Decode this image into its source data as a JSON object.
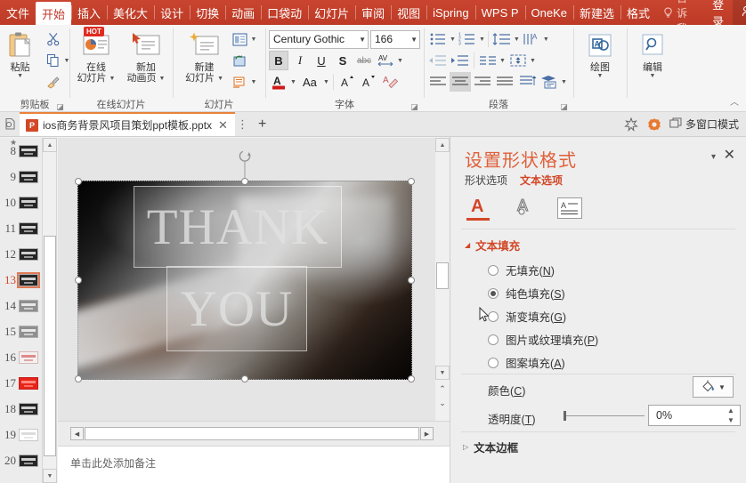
{
  "menubar": {
    "items": [
      {
        "label": "文件",
        "active": false
      },
      {
        "label": "开始",
        "active": true
      },
      {
        "label": "插入",
        "active": false
      },
      {
        "label": "美化大",
        "active": false
      },
      {
        "label": "设计",
        "active": false
      },
      {
        "label": "切换",
        "active": false
      },
      {
        "label": "动画",
        "active": false
      },
      {
        "label": "口袋动",
        "active": false
      },
      {
        "label": "幻灯片",
        "active": false
      },
      {
        "label": "审阅",
        "active": false
      },
      {
        "label": "视图",
        "active": false
      },
      {
        "label": "iSpring",
        "active": false
      },
      {
        "label": "WPS P",
        "active": false
      },
      {
        "label": "OneKe",
        "active": false
      },
      {
        "label": "新建选",
        "active": false
      },
      {
        "label": "格式",
        "active": false
      }
    ],
    "tell_me": "告诉我...",
    "login": "登录",
    "share": "共享",
    "accent_color": "#c0392b"
  },
  "ribbon": {
    "groups": [
      {
        "name": "剪贴板",
        "paste_label": "粘贴",
        "cut_tip": "剪切",
        "copy_tip": "复制",
        "painter_tip": "格式刷"
      },
      {
        "name": "在线幻灯片",
        "buttons": [
          {
            "line1": "在线",
            "line2": "幻灯片",
            "badge": "HOT"
          },
          {
            "line1": "新加",
            "line2": "动画页",
            "badge": ""
          }
        ]
      },
      {
        "name": "幻灯片",
        "buttons": [
          {
            "line1": "新建",
            "line2": "幻灯片"
          }
        ],
        "layout_tip": "版式",
        "reset_tip": "重置",
        "section_tip": "节"
      },
      {
        "name": "字体",
        "font_family": "Century Gothic",
        "font_size": "166",
        "bold": "B",
        "italic": "I",
        "underline": "U",
        "strike": "S",
        "text_effects": "abc",
        "char_spacing": "AV",
        "color_a": "A",
        "change_case": "Aa",
        "grow_font": "A",
        "shrink_font": "A",
        "clear_format_tip": "清除格式"
      },
      {
        "name": "段落",
        "bullets_tip": "项目符号",
        "numbering_tip": "编号",
        "line_spacing_tip": "行距",
        "text_direction_tip": "文字方向",
        "decrease_indent_tip": "减少缩进",
        "increase_indent_tip": "增加缩进",
        "align_columns_tip": "分栏",
        "align_text_tip": "对齐文本",
        "align_left_tip": "左对齐",
        "align_center_tip": "居中",
        "align_right_tip": "右对齐",
        "justify_tip": "两端对齐",
        "distribute_tip": "分散对齐",
        "smartart_tip": "转换为SmartArt"
      },
      {
        "name": "",
        "buttons": [
          {
            "line1": "绘图",
            "line2": ""
          },
          {
            "line1": "编辑",
            "line2": ""
          }
        ]
      }
    ],
    "collapse_tip": "折叠功能区"
  },
  "tabbar": {
    "document_name": "ios商务背景风项目策划ppt模板.pptx",
    "close_tab": "✕",
    "more_menu": "⋮",
    "new_tab": "+",
    "multiwindow_label": "多窗口模式",
    "backstage_tip": "首页",
    "tools_tip": "工具",
    "settings_tip": "设置"
  },
  "thumbnails": {
    "selected_index": 13,
    "slides": [
      {
        "num": "8",
        "style": "dark"
      },
      {
        "num": "9",
        "style": "dark"
      },
      {
        "num": "10",
        "style": "dark"
      },
      {
        "num": "11",
        "style": "dark"
      },
      {
        "num": "12",
        "style": "dark"
      },
      {
        "num": "13",
        "style": "dark"
      },
      {
        "num": "14",
        "style": "gray"
      },
      {
        "num": "15",
        "style": "gray"
      },
      {
        "num": "16",
        "style": "light"
      },
      {
        "num": "17",
        "style": "red"
      },
      {
        "num": "18",
        "style": "dark"
      },
      {
        "num": "19",
        "style": "white"
      },
      {
        "num": "20",
        "style": "dark"
      }
    ]
  },
  "slide": {
    "title_text": "THANK",
    "subtitle_text": "YOU",
    "notes_placeholder": "单击此处添加备注"
  },
  "format_panel": {
    "title": "设置形状格式",
    "tabs": [
      {
        "label": "形状选项",
        "active": false
      },
      {
        "label": "文本选项",
        "active": true
      }
    ],
    "icon_tabs": [
      {
        "name": "text-fill-icon",
        "label": "A"
      },
      {
        "name": "text-effects-icon",
        "label": "A"
      },
      {
        "name": "textbox-icon",
        "label": "A"
      }
    ],
    "section_fill": {
      "title": "文本填充",
      "expanded": true,
      "options": [
        {
          "label": "无填充",
          "accel": "N",
          "selected": false
        },
        {
          "label": "纯色填充",
          "accel": "S",
          "selected": true
        },
        {
          "label": "渐变填充",
          "accel": "G",
          "selected": false
        },
        {
          "label": "图片或纹理填充",
          "accel": "P",
          "selected": false
        },
        {
          "label": "图案填充",
          "accel": "A",
          "selected": false
        }
      ],
      "color_label": "颜色",
      "color_accel": "C",
      "transparency_label": "透明度",
      "transparency_accel": "T",
      "transparency_value": "0%",
      "transparency_percent": 0
    },
    "section_outline": {
      "title": "文本边框",
      "expanded": false
    },
    "collapse_icon": "▾",
    "close_icon": "✕",
    "accent_color": "#d24726"
  }
}
